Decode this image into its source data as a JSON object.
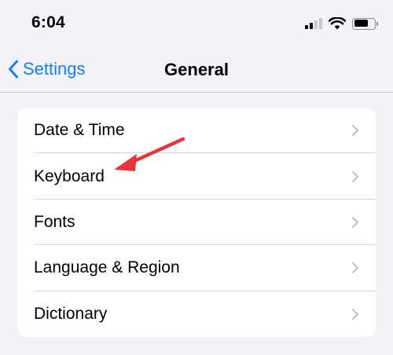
{
  "status_bar": {
    "time": "6:04",
    "icons": [
      "cellular-signal-icon",
      "wifi-icon",
      "battery-icon"
    ]
  },
  "nav_bar": {
    "back_label": "Settings",
    "title": "General"
  },
  "list": {
    "items": [
      {
        "label": "Date & Time"
      },
      {
        "label": "Keyboard"
      },
      {
        "label": "Fonts"
      },
      {
        "label": "Language & Region"
      },
      {
        "label": "Dictionary"
      }
    ]
  },
  "annotation": {
    "arrow_color": "#e8333a",
    "points_to": "Keyboard"
  },
  "colors": {
    "accent": "#147efb",
    "background": "#f2f2f7",
    "cell": "#ffffff",
    "chevron": "#c4c4c7"
  }
}
